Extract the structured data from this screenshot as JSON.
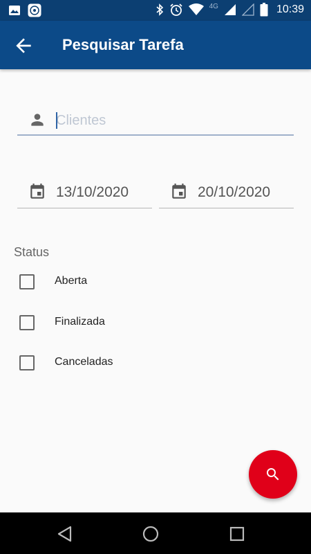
{
  "status_bar": {
    "time": "10:39",
    "network": "4G",
    "icons": [
      "image-icon",
      "app-icon",
      "bluetooth-icon",
      "alarm-icon",
      "wifi-icon",
      "signal-icon",
      "signal-empty-icon",
      "battery-icon"
    ]
  },
  "app_bar": {
    "title": "Pesquisar Tarefa",
    "back_icon": "arrow-back-icon"
  },
  "client_field": {
    "placeholder": "Clientes",
    "value": "",
    "icon": "person-icon"
  },
  "dates": {
    "start": "13/10/2020",
    "end": "20/10/2020",
    "icon": "calendar-icon"
  },
  "status": {
    "label": "Status",
    "options": [
      {
        "label": "Aberta",
        "checked": false
      },
      {
        "label": "Finalizada",
        "checked": false
      },
      {
        "label": "Canceladas",
        "checked": false
      }
    ]
  },
  "fab": {
    "icon": "search-icon"
  },
  "colors": {
    "status_bar": "#0c3f72",
    "app_bar": "#0c4a88",
    "fab": "#e00019",
    "background": "#fafafa"
  },
  "nav_bar": {
    "icons": [
      "back-triangle-icon",
      "home-circle-icon",
      "recents-square-icon"
    ]
  }
}
